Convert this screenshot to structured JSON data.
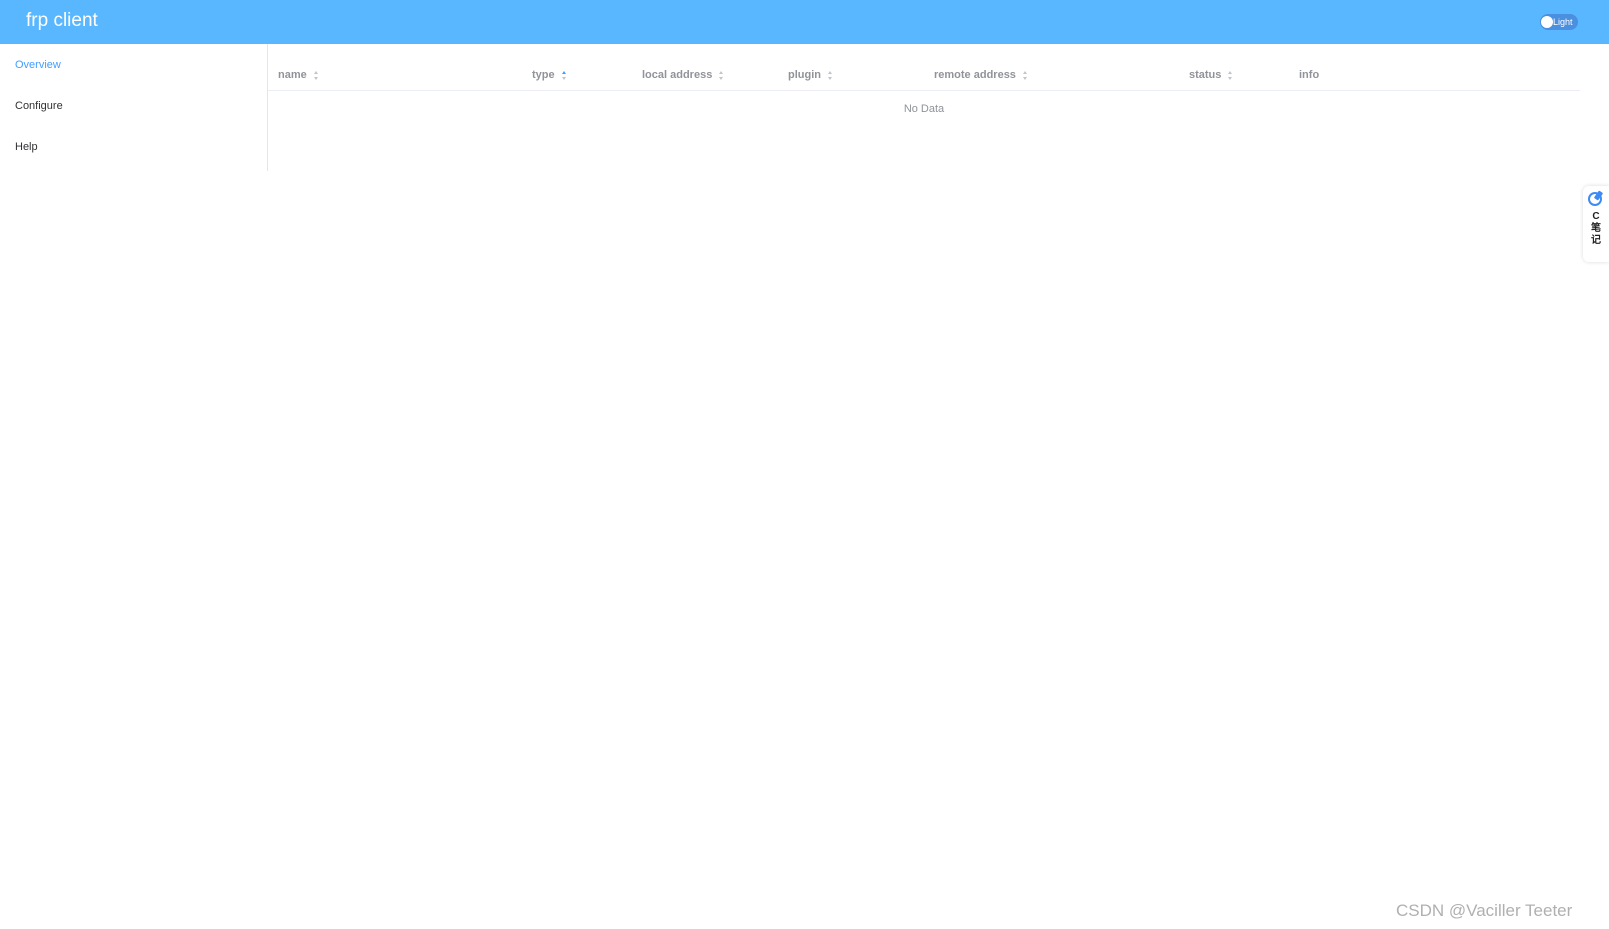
{
  "header": {
    "title": "frp client",
    "theme_switch_label": "Light"
  },
  "sidebar": {
    "items": [
      {
        "label": "Overview",
        "active": true
      },
      {
        "label": "Configure",
        "active": false
      },
      {
        "label": "Help",
        "active": false
      }
    ]
  },
  "table": {
    "columns": [
      {
        "label": "name",
        "sortable": true
      },
      {
        "label": "type",
        "sortable": true,
        "sort": "asc"
      },
      {
        "label": "local address",
        "sortable": true
      },
      {
        "label": "plugin",
        "sortable": true
      },
      {
        "label": "remote address",
        "sortable": true
      },
      {
        "label": "status",
        "sortable": true
      },
      {
        "label": "info",
        "sortable": false
      }
    ],
    "empty_text": "No Data"
  },
  "side_tool": {
    "label": "C笔记",
    "icon": "pen-note-icon"
  },
  "watermark": "CSDN @Vaciller Teeter",
  "colors": {
    "header_bg": "#58b7ff",
    "accent": "#409eff",
    "header_text": "#909399"
  }
}
